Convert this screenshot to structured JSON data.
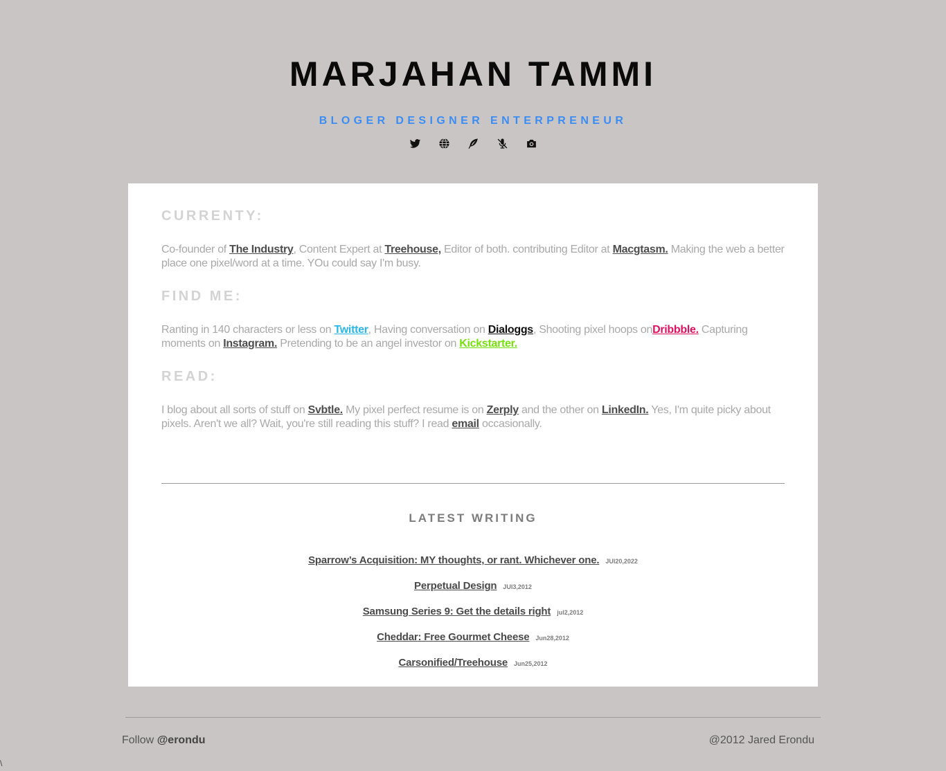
{
  "header": {
    "name": "MARJAHAN TAMMI",
    "tagline": "BLOGER DESIGNER ENTERPRENEUR",
    "social_icons": [
      "twitter-icon",
      "globe-icon",
      "feather-icon",
      "microphone-off-icon",
      "camera-icon"
    ]
  },
  "currently": {
    "title": "CURRENTY:",
    "t1": "Co-founder of ",
    "l1": "The Industry",
    "t2": ", Content Expert at ",
    "l2": "Treehouse,",
    "t3": " Editor of both. contributing Editor at ",
    "l3": "Macgtasm.",
    "t4": " Making the web a better place one pixel/word at a time. YOu could say I'm busy."
  },
  "find_me": {
    "title": "FIND ME:",
    "t1": "Ranting in 140 characters or less on ",
    "l1": "Twitter",
    "t2": ", Having conversation on ",
    "l2": "Dialoggs",
    "t3": ", Shooting pixel hoops on",
    "l3": "Dribbble.",
    "t4": " Capturing moments on ",
    "l4": "Instagram.",
    "t5": " Pretending to be an angel investor on ",
    "l5": "Kickstarter."
  },
  "read": {
    "title": "READ:",
    "t1": "I blog about all sorts of stuff on ",
    "l1": "Svbtle.",
    "t2": " My pixel perfect resume is on ",
    "l2": "Zerply",
    "t3": " and the other on ",
    "l3": "LinkedIn.",
    "t4": " Yes, I'm quite picky about pixels. Aren't we all? Wait, you're still reading this stuff? I read ",
    "l4": "email",
    "t5": " occasionally."
  },
  "latest_writing": {
    "title": "LATEST WRITING",
    "posts": [
      {
        "title": "Sparrow’s Acquisition: MY thoughts, or rant. Whichever one.",
        "date": "JUl20,2022"
      },
      {
        "title": "Perpetual Design",
        "date": "JUl3,2012"
      },
      {
        "title": "Samsung Series 9: Get the details right",
        "date": "jul2,2012"
      },
      {
        "title": "Cheddar: Free Gourmet Cheese",
        "date": "Jun28,2012"
      },
      {
        "title": "Carsonified/Treehouse",
        "date": "Jun25,2012"
      }
    ]
  },
  "footer": {
    "follow_label": "Follow ",
    "handle": "@erondu",
    "copyright": "@2012 Jared Erondu",
    "corner_mark": "\\"
  }
}
